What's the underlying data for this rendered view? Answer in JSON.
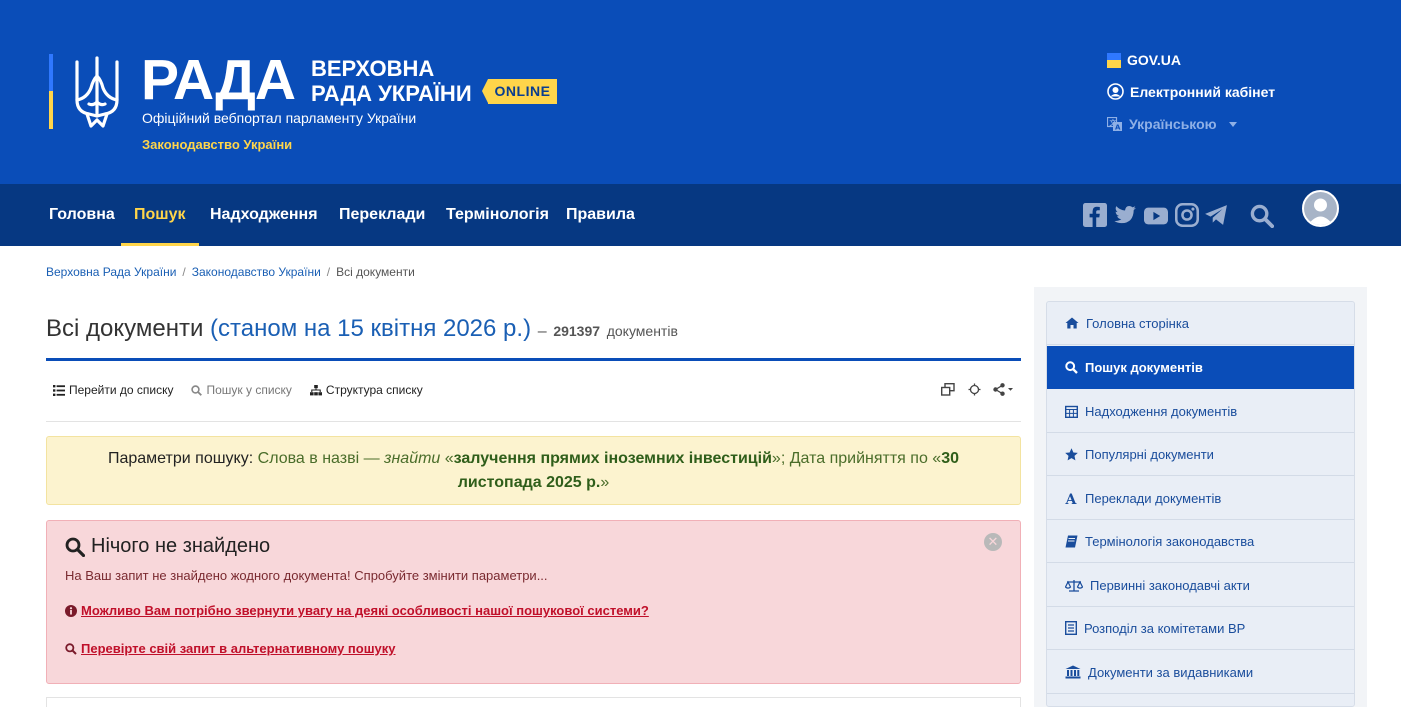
{
  "header": {
    "logo_text": "РАДА",
    "name_line1": "ВЕРХОВНА",
    "name_line2": "РАДА УКРАЇНИ",
    "online_badge": "ONLINE",
    "subtitle": "Офіційний вебпортал парламенту України",
    "section": "Законодавство України",
    "gov_link": "GOV.UA",
    "cabinet_link": "Електронний кабінет",
    "language": "Українською"
  },
  "nav": {
    "items": [
      {
        "label": "Головна"
      },
      {
        "label": "Пошук"
      },
      {
        "label": "Надходження"
      },
      {
        "label": "Переклади"
      },
      {
        "label": "Термінологія"
      },
      {
        "label": "Правила"
      }
    ],
    "active": "Пошук",
    "icons": [
      "facebook-icon",
      "twitter-icon",
      "youtube-icon",
      "instagram-icon",
      "telegram-icon",
      "search-icon",
      "user-avatar-icon"
    ]
  },
  "breadcrumb": {
    "items": [
      "Верховна Рада України",
      "Законодавство України",
      "Всі документи"
    ],
    "separator": "/"
  },
  "page": {
    "title": "Всі документи",
    "date_note": "(станом на 15 квітня 2026 р.)",
    "dash": "–",
    "count": "291397",
    "count_unit": "документів"
  },
  "toolbar": {
    "goto_list": "Перейти до списку",
    "search_in_list": "Пошук у списку",
    "list_structure": "Структура списку"
  },
  "params": {
    "label": "Параметри пошуку:",
    "part1": " Слова в назві — ",
    "find": "знайти",
    "open_quote": " «",
    "phrase": "залучення прямих іноземних інвестицій",
    "part2": "»; Дата прийняття по «",
    "date": "30 листопада 2025 р.",
    "close_quote": "»"
  },
  "not_found": {
    "title": "Нічого не знайдено",
    "text": "На Ваш запит не знайдено жодного документа! Спробуйте змінити параметри...",
    "link1": "Можливо Вам потрібно звернути увагу на деякі особливості нашої пошукової системи?",
    "link2": "Перевірте свій запит в альтернативному пошуку",
    "close_symbol": "✕"
  },
  "sidebar": {
    "items": [
      {
        "label": "Головна сторінка",
        "icon": "home-icon"
      },
      {
        "label": "Пошук документів",
        "icon": "search-icon"
      },
      {
        "label": "Надходження документів",
        "icon": "calendar-icon"
      },
      {
        "label": "Популярні документи",
        "icon": "star-icon"
      },
      {
        "label": "Переклади документів",
        "icon": "font-icon"
      },
      {
        "label": "Термінологія законодавства",
        "icon": "book-icon"
      },
      {
        "label": "Первинні законодавчі акти",
        "icon": "scales-icon"
      },
      {
        "label": "Розподіл за комітетами ВР",
        "icon": "list-book-icon"
      },
      {
        "label": "Документи за видавниками",
        "icon": "institution-icon"
      }
    ],
    "active": "Пошук документів"
  },
  "colors": {
    "header_blue": "#0a4db8",
    "nav_blue": "#063882",
    "accent_yellow": "#ffd54a",
    "params_bg": "#fcf3cf",
    "error_bg": "#f8d7da"
  }
}
